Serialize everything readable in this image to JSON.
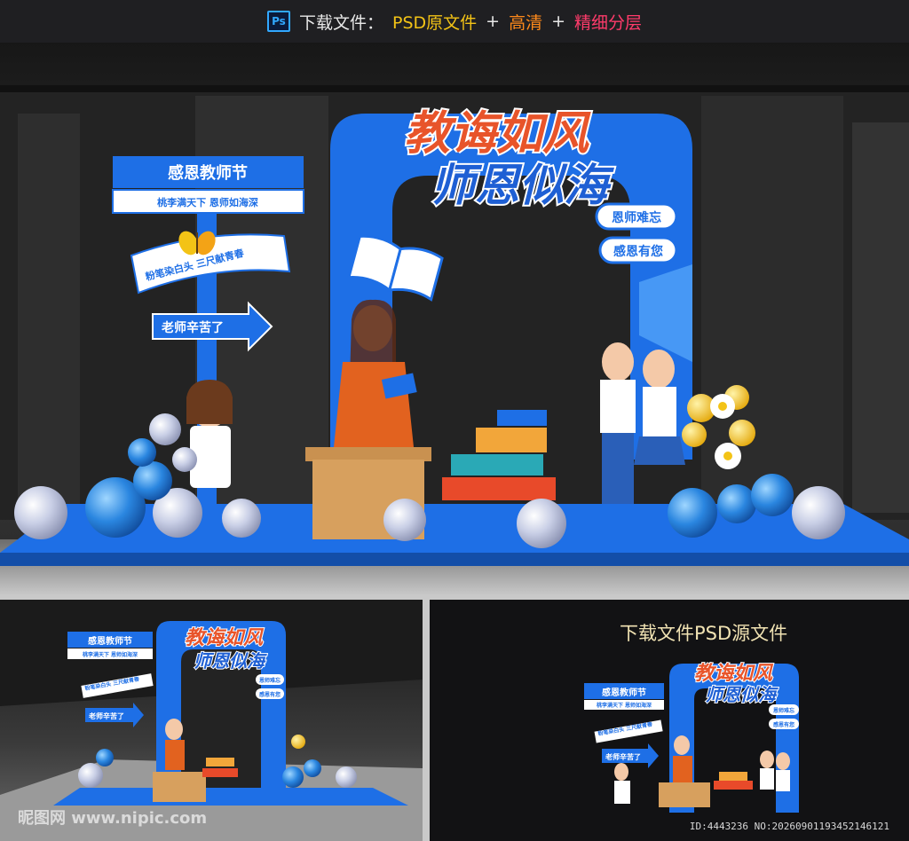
{
  "header": {
    "ps_icon": "Ps",
    "download_label": "下载文件：",
    "psd_label": "PSD原文件",
    "plus1": "+",
    "hd_label": "高清",
    "plus2": "+",
    "layers_label": "精细分层"
  },
  "design": {
    "title_line1": "教诲如风",
    "title_line2": "师恩似海",
    "sign_title": "感恩教师节",
    "sign_sub": "桃李满天下  恩师如海深",
    "banner_curve": "粉笔染白头  三尺献青春",
    "arrow_label": "老师辛苦了",
    "bubble1": "恩师难忘",
    "bubble2": "感恩有您"
  },
  "small_sign_sub": "桃李满天下  恩师如海深",
  "preview": {
    "download_text": "下载文件PSD源文件"
  },
  "watermark": {
    "logo": "昵图网 www.nipic.com",
    "id_text": "ID:4443236 NO:20260901193452146121"
  },
  "colors": {
    "brand_blue": "#1e6fe6",
    "title_orange": "#e8542a",
    "accent_yellow": "#f3c316"
  },
  "icons": [
    "butterfly-icon",
    "book-icon",
    "balloon-icon",
    "flower-icon"
  ]
}
